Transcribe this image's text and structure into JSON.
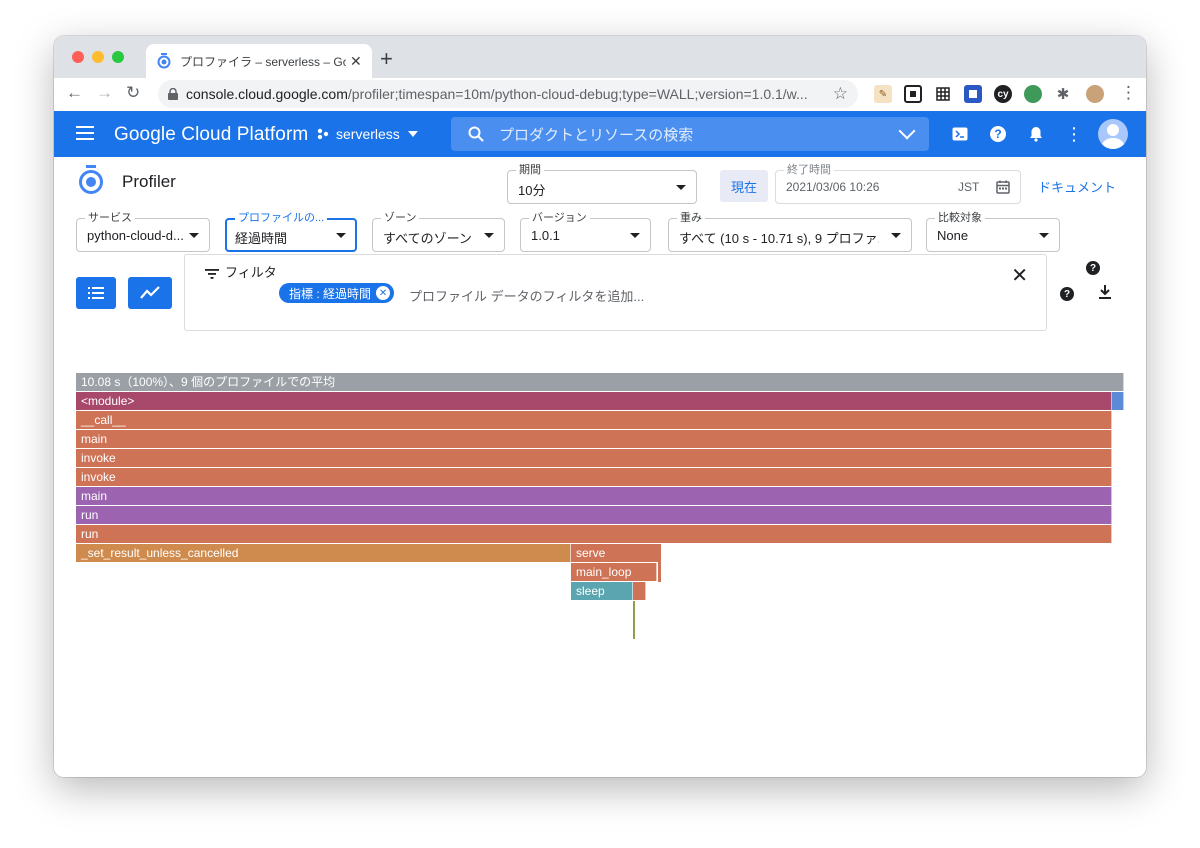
{
  "browser": {
    "tab_title": "プロファイラ – serverless – Google Cloud Platform",
    "new_tab": "+",
    "url_host": "console.cloud.google.com",
    "url_path": "/profiler;timespan=10m/python-cloud-debug;type=WALL;version=1.0.1/w...",
    "colors": {
      "close": "#ff5f57",
      "minimize": "#febc2e",
      "zoom": "#28c840"
    }
  },
  "header": {
    "brand": "Google Cloud Platform",
    "project": "serverless",
    "search_placeholder": "プロダクトとリソースの検索",
    "accent": "#1a73e8"
  },
  "page": {
    "title": "Profiler",
    "period": {
      "label": "期間",
      "value": "10分"
    },
    "now_button": "現在",
    "end_time": {
      "label": "終了時間",
      "value": "2021/03/06 10:26",
      "tz": "JST"
    },
    "docs_link": "ドキュメント"
  },
  "filters": {
    "service": {
      "label": "サービス",
      "value": "python-cloud-d..."
    },
    "profile_type": {
      "label": "プロファイルの...",
      "value": "経過時間"
    },
    "zone": {
      "label": "ゾーン",
      "value": "すべてのゾーン"
    },
    "version": {
      "label": "バージョン",
      "value": "1.0.1"
    },
    "weight": {
      "label": "重み",
      "value": "すべて (10 s - 10.71 s), 9 プロファ..."
    },
    "compare": {
      "label": "比較対象",
      "value": "None"
    }
  },
  "filter_bar": {
    "label": "フィルタ",
    "chip": "指標 : 経過時間",
    "placeholder": "プロファイル データのフィルタを追加..."
  },
  "flame_graph": {
    "root_label": "10.08 s（100%）、9 個のプロファイルでの平均",
    "frames": [
      {
        "name": "<module>",
        "depth": 1,
        "start": 0.0,
        "width": 0.9885,
        "color": "#a8486a"
      },
      {
        "name": "",
        "depth": 1,
        "start": 0.9885,
        "width": 0.0115,
        "color": "#5b8ad6"
      },
      {
        "name": "__call__",
        "depth": 2,
        "start": 0.0,
        "width": 0.9885,
        "color": "#cf7356"
      },
      {
        "name": "main",
        "depth": 3,
        "start": 0.0,
        "width": 0.9885,
        "color": "#cf7356"
      },
      {
        "name": "invoke",
        "depth": 4,
        "start": 0.0,
        "width": 0.9885,
        "color": "#cf7356"
      },
      {
        "name": "invoke",
        "depth": 5,
        "start": 0.0,
        "width": 0.9885,
        "color": "#cf7356"
      },
      {
        "name": "main",
        "depth": 6,
        "start": 0.0,
        "width": 0.9885,
        "color": "#9b63b0"
      },
      {
        "name": "run",
        "depth": 7,
        "start": 0.0,
        "width": 0.9885,
        "color": "#9b63b0"
      },
      {
        "name": "run",
        "depth": 8,
        "start": 0.0,
        "width": 0.9885,
        "color": "#cf7356"
      },
      {
        "name": "_set_result_unless_cancelled",
        "depth": 9,
        "start": 0.0,
        "width": 0.472,
        "color": "#cf8a4e"
      },
      {
        "name": "serve",
        "depth": 9,
        "start": 0.472,
        "width": 0.0835,
        "color": "#cf7356"
      },
      {
        "name": "",
        "depth": 9,
        "start": 0.5555,
        "width": 0.0025,
        "color": "#cf7356"
      },
      {
        "name": "main_loop",
        "depth": 10,
        "start": 0.472,
        "width": 0.0825,
        "color": "#cf7356"
      },
      {
        "name": "sleep",
        "depth": 11,
        "start": 0.472,
        "width": 0.0595,
        "color": "#5aa5b0"
      },
      {
        "name": "",
        "depth": 11,
        "start": 0.5315,
        "width": 0.012,
        "color": "#cf7356"
      },
      {
        "name": "",
        "depth": 12,
        "start": 0.5315,
        "width": 0.002,
        "color": "#8aa04a"
      }
    ]
  }
}
